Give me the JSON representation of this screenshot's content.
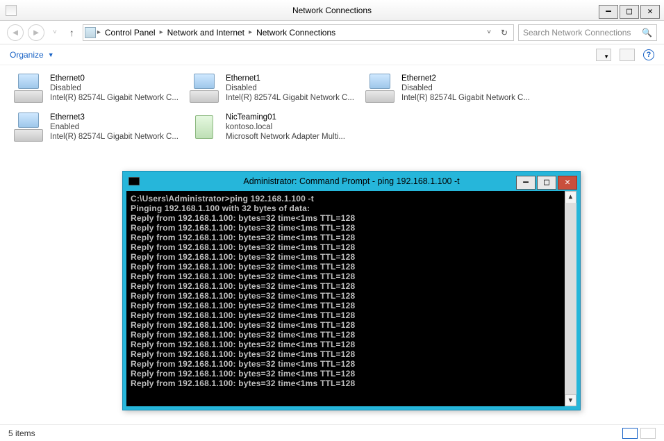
{
  "window": {
    "title": "Network Connections"
  },
  "breadcrumb": {
    "seg1": "Control Panel",
    "seg2": "Network and Internet",
    "seg3": "Network Connections"
  },
  "search": {
    "placeholder": "Search Network Connections"
  },
  "commandbar": {
    "organize": "Organize"
  },
  "adapters": [
    {
      "name": "Ethernet0",
      "status": "Disabled",
      "desc": "Intel(R) 82574L Gigabit Network C...",
      "kind": "nic"
    },
    {
      "name": "Ethernet1",
      "status": "Disabled",
      "desc": "Intel(R) 82574L Gigabit Network C...",
      "kind": "nic"
    },
    {
      "name": "Ethernet2",
      "status": "Disabled",
      "desc": "Intel(R) 82574L Gigabit Network C...",
      "kind": "nic"
    },
    {
      "name": "Ethernet3",
      "status": "Enabled",
      "desc": "Intel(R) 82574L Gigabit Network C...",
      "kind": "nic"
    },
    {
      "name": "NicTeaming01",
      "status": "kontoso.local",
      "desc": "Microsoft Network Adapter Multi...",
      "kind": "team"
    }
  ],
  "statusbar": {
    "items": "5 items"
  },
  "cmd": {
    "title": "Administrator: Command Prompt - ping  192.168.1.100 -t",
    "lines": [
      "C:\\Users\\Administrator>ping 192.168.1.100 -t",
      "",
      "Pinging 192.168.1.100 with 32 bytes of data:",
      "Reply from 192.168.1.100: bytes=32 time<1ms TTL=128",
      "Reply from 192.168.1.100: bytes=32 time<1ms TTL=128",
      "Reply from 192.168.1.100: bytes=32 time<1ms TTL=128",
      "Reply from 192.168.1.100: bytes=32 time<1ms TTL=128",
      "Reply from 192.168.1.100: bytes=32 time<1ms TTL=128",
      "Reply from 192.168.1.100: bytes=32 time<1ms TTL=128",
      "Reply from 192.168.1.100: bytes=32 time<1ms TTL=128",
      "Reply from 192.168.1.100: bytes=32 time<1ms TTL=128",
      "Reply from 192.168.1.100: bytes=32 time<1ms TTL=128",
      "Reply from 192.168.1.100: bytes=32 time<1ms TTL=128",
      "Reply from 192.168.1.100: bytes=32 time<1ms TTL=128",
      "Reply from 192.168.1.100: bytes=32 time<1ms TTL=128",
      "Reply from 192.168.1.100: bytes=32 time<1ms TTL=128",
      "Reply from 192.168.1.100: bytes=32 time<1ms TTL=128",
      "Reply from 192.168.1.100: bytes=32 time<1ms TTL=128",
      "Reply from 192.168.1.100: bytes=32 time<1ms TTL=128",
      "Reply from 192.168.1.100: bytes=32 time<1ms TTL=128",
      "Reply from 192.168.1.100: bytes=32 time<1ms TTL=128"
    ]
  }
}
